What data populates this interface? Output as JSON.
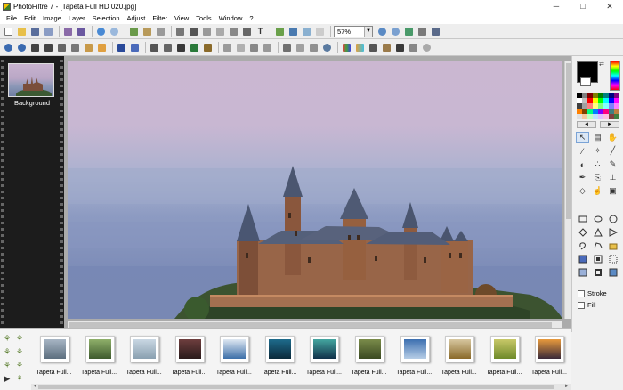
{
  "window": {
    "title": "PhotoFiltre 7 - [Tapeta Full HD 020.jpg]",
    "minimize": "─",
    "maximize": "□",
    "close": "✕"
  },
  "menu": [
    "File",
    "Edit",
    "Image",
    "Layer",
    "Selection",
    "Adjust",
    "Filter",
    "View",
    "Tools",
    "Window",
    "?"
  ],
  "toolbar": {
    "zoom_value": "57%",
    "zoom_arrow": "▼"
  },
  "layers": {
    "items": [
      {
        "label": "Background"
      }
    ]
  },
  "colors": {
    "foreground": "#000000",
    "background": "#ffffff",
    "palette": [
      "#000000",
      "#808080",
      "#800000",
      "#808000",
      "#008000",
      "#008080",
      "#000080",
      "#800080",
      "#ffffff",
      "#c0c0c0",
      "#ff0000",
      "#ffff00",
      "#00ff00",
      "#00ffff",
      "#0000ff",
      "#ff00ff",
      "#404040",
      "#a0a0a0",
      "#ff8080",
      "#ffff80",
      "#80ff80",
      "#80ffff",
      "#8080ff",
      "#ff80ff",
      "#ff8000",
      "#804000",
      "#00ff80",
      "#0080ff",
      "#8000ff",
      "#ff0080",
      "#408080",
      "#c08040",
      "#e0e0e0",
      "#f4c7a0",
      "#c0ffc0",
      "#c0e0ff",
      "#e0c0ff",
      "#ffc0e0",
      "#804040",
      "#408040"
    ]
  },
  "palette_nav": {
    "prev": "◄",
    "next": "►"
  },
  "tools": {
    "stroke_label": "Stroke",
    "fill_label": "Fill"
  },
  "filmstrip": {
    "items": [
      {
        "label": "Tapeta Full...",
        "colors": [
          "#a7b5c4",
          "#5d6f7f"
        ]
      },
      {
        "label": "Tapeta Full...",
        "colors": [
          "#8fb06a",
          "#3f5b2e"
        ]
      },
      {
        "label": "Tapeta Full...",
        "colors": [
          "#c9d7e3",
          "#8aa0b0"
        ]
      },
      {
        "label": "Tapeta Full...",
        "colors": [
          "#6e3e3e",
          "#2a1b1b"
        ]
      },
      {
        "label": "Tapeta Full...",
        "colors": [
          "#dfe8f2",
          "#3c6fa8"
        ]
      },
      {
        "label": "Tapeta Full...",
        "colors": [
          "#1e6b8c",
          "#0b2a3b"
        ]
      },
      {
        "label": "Tapeta Full...",
        "colors": [
          "#44a6a0",
          "#11324a"
        ]
      },
      {
        "label": "Tapeta Full...",
        "colors": [
          "#7a8b4a",
          "#3b4a22"
        ]
      },
      {
        "label": "Tapeta Full...",
        "colors": [
          "#3c6fb0",
          "#b6cde6"
        ]
      },
      {
        "label": "Tapeta Full...",
        "colors": [
          "#d7c7a0",
          "#8a6a2a"
        ]
      },
      {
        "label": "Tapeta Full...",
        "colors": [
          "#c8c868",
          "#6f8a2a"
        ]
      },
      {
        "label": "Tapeta Full...",
        "colors": [
          "#e89a3c",
          "#3a2a3a"
        ]
      }
    ]
  }
}
